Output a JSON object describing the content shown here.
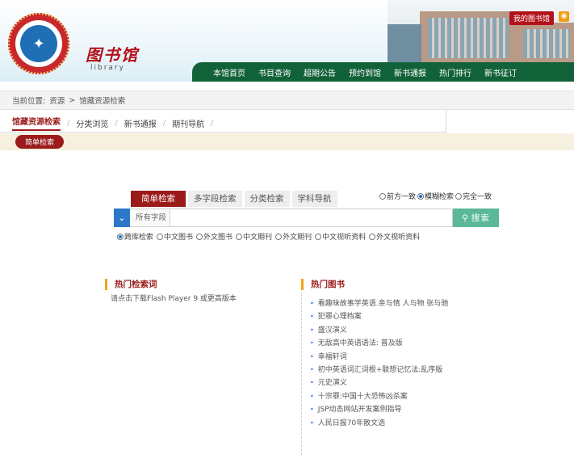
{
  "header": {
    "logo_icon": "library-seal-icon",
    "brand_cn": "图书馆",
    "brand_en": "library",
    "my_library": "我的图书馆",
    "rss_icon": "rss-icon"
  },
  "nav": {
    "items": [
      "本馆首页",
      "书目查询",
      "超期公告",
      "预约到馆",
      "新书通报",
      "热门排行",
      "新书征订"
    ]
  },
  "breadcrumb": {
    "prefix": "当前位置:",
    "level1": "资源",
    "separator": ">",
    "level2": "馆藏资源检索"
  },
  "section_tabs": {
    "items": [
      "馆藏资源检索",
      "分类浏览",
      "新书通报",
      "期刊导航"
    ],
    "active_index": 0
  },
  "simple_search_label": "简单检索",
  "search": {
    "tabs": [
      "简单检索",
      "多字段检索",
      "分类检索",
      "学科导航"
    ],
    "active_tab": 0,
    "match_options": [
      "前方一致",
      "模糊检索",
      "完全一致"
    ],
    "match_selected": 1,
    "field_label": "所有字段",
    "query_value": "",
    "button_label": "搜索",
    "scopes": [
      "跨库检索",
      "中文图书",
      "外文图书",
      "中文期刊",
      "外文期刊",
      "中文视听资料",
      "外文视听资料"
    ],
    "scope_selected": 0
  },
  "hot_searches": {
    "title": "热门检索词",
    "note": "请点击下载Flash Player 9 或更高版本"
  },
  "hot_books": {
    "title": "热门图书",
    "items": [
      "看趣味故事学英语.亲与情 人与物   张与驰",
      "犯罪心理档案",
      "盛汉演义",
      "无敌高中英语语法: 普及版",
      "幸福轩词",
      "初中英语词汇词根+联想记忆法:乱序版",
      "元史演义",
      "十宗罪:中国十大恐怖凶杀案",
      "JSP动态网站开发案例指导",
      "人民日报70年散文选"
    ]
  },
  "colors": {
    "brand_red": "#9b1a1a",
    "nav_green": "#116139",
    "search_green": "#5bb89a",
    "accent_orange": "#f0a21b"
  }
}
